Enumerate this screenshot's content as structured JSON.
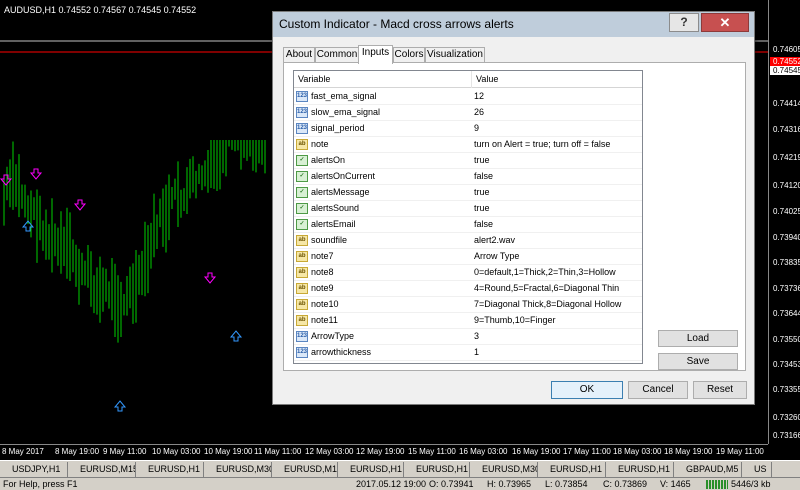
{
  "chart": {
    "title": "AUDUSD,H1  0.74552 0.74567 0.74545 0.74552",
    "price_ticks": [
      "0.74605",
      "0.74552",
      "0.74545",
      "0.74414",
      "0.74316",
      "0.74219",
      "0.74120",
      "0.74025",
      "0.73940",
      "0.73835",
      "0.73736",
      "0.73644",
      "0.73550",
      "0.73453",
      "0.73355",
      "0.73260",
      "0.73166"
    ],
    "time_ticks": [
      "8 May 2017",
      "8 May 19:00",
      "9 May 11:00",
      "10 May 03:00",
      "10 May 19:00",
      "11 May 11:00",
      "12 May 03:00",
      "12 May 19:00",
      "15 May 11:00",
      "16 May 03:00",
      "16 May 19:00",
      "17 May 11:00",
      "18 May 03:00",
      "18 May 19:00",
      "19 May 11:00"
    ],
    "colors": {
      "bars": "#00d000",
      "arrow_down": "#ff00ff",
      "arrow_up": "#3399ff",
      "bid_line": "#ff0000",
      "ask_line": "#c0c0c0"
    }
  },
  "chart_tabs": [
    "USDJPY,H1",
    "EURUSD,M15",
    "EURUSD,H1",
    "EURUSD,M30",
    "EURUSD,M1",
    "EURUSD,H1",
    "EURUSD,H1",
    "EURUSD,M30",
    "EURUSD,H1",
    "EURUSD,H1",
    "GBPAUD,M5",
    "US"
  ],
  "status": {
    "help": "For Help, press F1",
    "datetime": "2017.05.12 19:00",
    "open": "O: 0.73941",
    "high": "H: 0.73965",
    "low": "L: 0.73854",
    "close": "C: 0.73869",
    "volume": "V: 1465",
    "traffic": "5446/3 kb"
  },
  "dialog": {
    "title": "Custom Indicator - Macd cross arrows alerts",
    "help_label": "?",
    "close_label": "✕",
    "tabs": [
      "About",
      "Common",
      "Inputs",
      "Colors",
      "Visualization"
    ],
    "active_tab": "Inputs",
    "columns": [
      "Variable",
      "Value"
    ],
    "rows": [
      {
        "type": "123",
        "name": "fast_ema_signal",
        "value": "12"
      },
      {
        "type": "123",
        "name": "slow_ema_signal",
        "value": "26"
      },
      {
        "type": "123",
        "name": "signal_period",
        "value": "9"
      },
      {
        "type": "ab",
        "name": "note",
        "value": "turn on Alert = true; turn off = false"
      },
      {
        "type": "bool",
        "name": "alertsOn",
        "value": "true"
      },
      {
        "type": "bool",
        "name": "alertsOnCurrent",
        "value": "false"
      },
      {
        "type": "bool",
        "name": "alertsMessage",
        "value": "true"
      },
      {
        "type": "bool",
        "name": "alertsSound",
        "value": "true"
      },
      {
        "type": "bool",
        "name": "alertsEmail",
        "value": "false"
      },
      {
        "type": "ab",
        "name": "soundfile",
        "value": "alert2.wav"
      },
      {
        "type": "ab",
        "name": "note7",
        "value": "Arrow Type"
      },
      {
        "type": "ab",
        "name": "note8",
        "value": "0=default,1=Thick,2=Thin,3=Hollow"
      },
      {
        "type": "ab",
        "name": "note9",
        "value": "4=Round,5=Fractal,6=Diagonal Thin"
      },
      {
        "type": "ab",
        "name": "note10",
        "value": "7=Diagonal Thick,8=Diagonal Hollow"
      },
      {
        "type": "ab",
        "name": "note11",
        "value": "9=Thumb,10=Finger"
      },
      {
        "type": "123",
        "name": "ArrowType",
        "value": "3"
      },
      {
        "type": "123",
        "name": "arrowthickness",
        "value": "1"
      }
    ],
    "buttons": {
      "load": "Load",
      "save": "Save",
      "ok": "OK",
      "cancel": "Cancel",
      "reset": "Reset"
    }
  }
}
